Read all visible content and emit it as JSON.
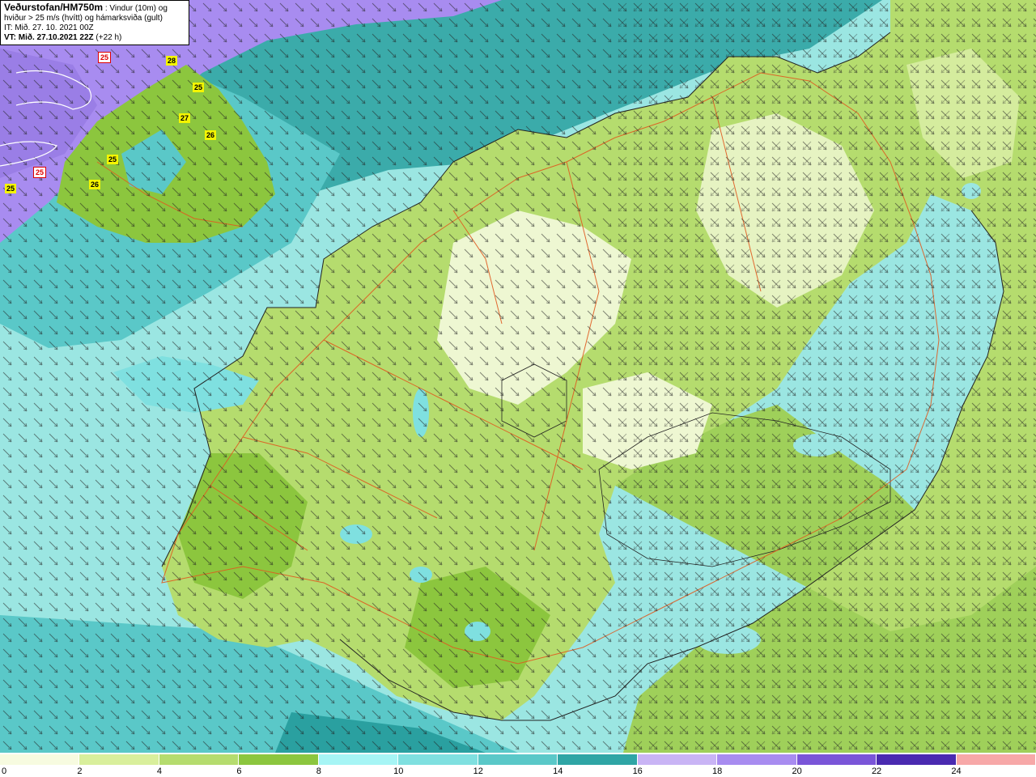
{
  "header": {
    "title": "Veðurstofan/HM750m",
    "title_suffix": " : Vindur (10m) og",
    "line2": "hviður > 25 m/s (hvítt) og hámarksviða (gult)",
    "it_line": "IT: Mið. 27. 10. 2021 00Z",
    "vt_line": "VT: Mið. 27.10.2021 22Z",
    "vt_suffix": " (+22 h)"
  },
  "gust_labels": [
    {
      "text": "28",
      "style": "yellow"
    },
    {
      "text": "25",
      "style": "yellow"
    },
    {
      "text": "27",
      "style": "yellow"
    },
    {
      "text": "26",
      "style": "yellow"
    },
    {
      "text": "25",
      "style": "yellow"
    },
    {
      "text": "26",
      "style": "yellow"
    },
    {
      "text": "25",
      "style": "yellow"
    },
    {
      "text": "25",
      "style": "white"
    },
    {
      "text": "25",
      "style": "white"
    }
  ],
  "legend": {
    "ticks": [
      "0",
      "2",
      "4",
      "6",
      "8",
      "10",
      "12",
      "14",
      "16",
      "18",
      "20",
      "22",
      "24"
    ],
    "colors": [
      "#f7fbe0",
      "#d9ef9c",
      "#b5dc6e",
      "#8cc63e",
      "#a6f5f5",
      "#7fe0e0",
      "#5ac8c8",
      "#2fa5a5",
      "#c9b4f5",
      "#a88cf0",
      "#7a55d8",
      "#4a2ab0",
      "#f7a8a8"
    ]
  },
  "colors": {
    "land_light": "#eef7d2",
    "land_mid": "#b5dc6e",
    "land_dark": "#8cc63e",
    "sea_light": "#9be6e2",
    "sea_mid": "#5ac8c8",
    "sea_dark": "#2aa0a0",
    "sea_purple": "#a88cf0",
    "roads": "#e05a20",
    "coast": "#222222"
  }
}
